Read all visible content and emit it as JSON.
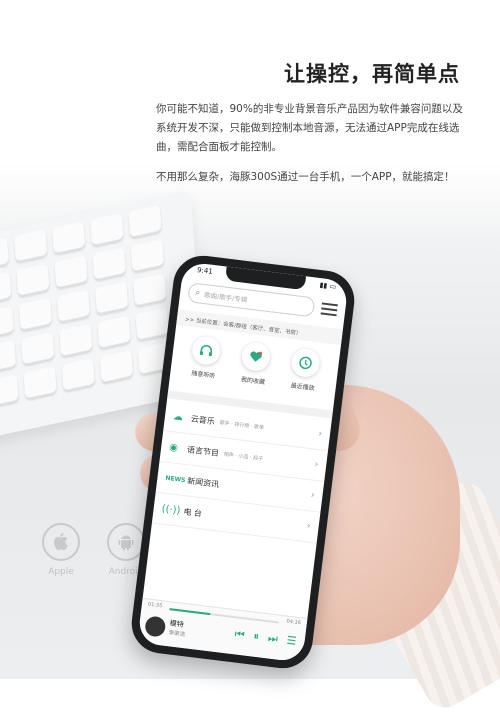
{
  "headline": "让操控，再简单点",
  "paragraph1": "你可能不知道，90%的非专业背景音乐产品因为软件兼容问题以及系统开发不深，只能做到控制本地音源，无法通过APP完成在线选曲，需配合面板才能控制。",
  "paragraph2": "不用那么复杂，海豚300S通过一台手机，一个APP，就能搞定！",
  "logos": [
    {
      "name": "apple-logo",
      "label": "Apple"
    },
    {
      "name": "android-logo",
      "label": "Android"
    }
  ],
  "app": {
    "status_time": "9:41",
    "search_placeholder": "歌曲/歌手/专辑",
    "location_text": ">> 当前位置：会客/群组（客厅、音室、书房）",
    "quick": [
      {
        "label": "随意听听"
      },
      {
        "label": "我的收藏"
      },
      {
        "label": "最近播放"
      }
    ],
    "list": [
      {
        "title": "云音乐",
        "sub": "歌手 · 排行榜 · 歌单"
      },
      {
        "title": "语言节目",
        "sub": "相声 · 小品 · 段子"
      },
      {
        "title": "新闻资讯",
        "sub": ""
      },
      {
        "title": "电 台",
        "sub": ""
      }
    ],
    "player": {
      "time_start": "01:35",
      "time_end": "04:16",
      "progress": 0.37,
      "song": "模特",
      "artist": "李荣浩"
    }
  },
  "colors": {
    "accent": "#2aa982"
  }
}
